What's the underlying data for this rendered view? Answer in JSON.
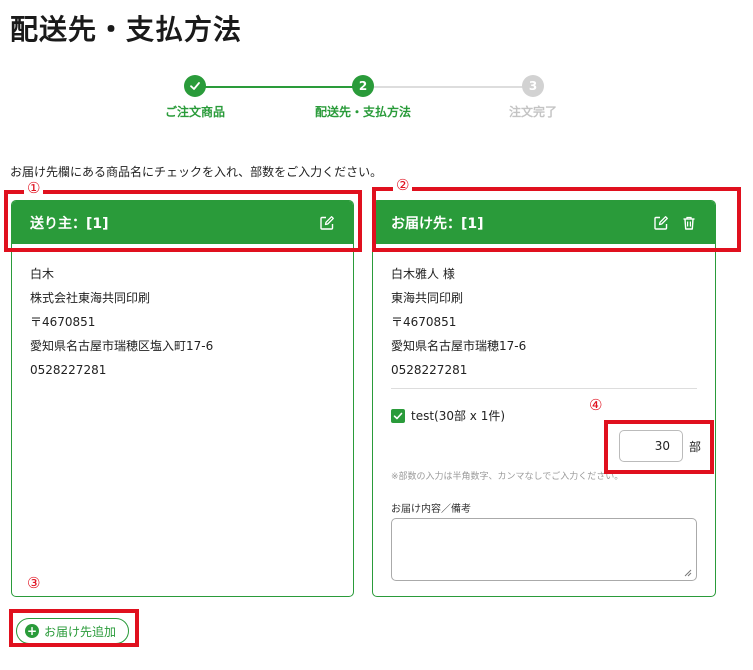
{
  "page_title": "配送先・支払方法",
  "stepper": {
    "steps": [
      {
        "number": "1",
        "label": "ご注文商品",
        "state": "done"
      },
      {
        "number": "2",
        "label": "配送先・支払方法",
        "state": "current"
      },
      {
        "number": "3",
        "label": "注文完了",
        "state": "todo"
      }
    ]
  },
  "instruction": "お届け先欄にある商品名にチェックを入れ、部数をご入力ください。",
  "sender": {
    "title": "送り主：[1]",
    "lines": [
      "白木",
      "株式会社東海共同印刷",
      "〒4670851",
      "愛知県名古屋市瑞穂区塩入町17-6",
      "0528227281"
    ]
  },
  "recipient": {
    "title": "お届け先：[1]",
    "lines": [
      "白木雅人 様",
      "東海共同印刷",
      "〒4670851",
      "愛知県名古屋市瑞穂17-6",
      "0528227281"
    ],
    "item_label": "test(30部 x 1件)",
    "item_checked": true,
    "quantity": "30",
    "quantity_unit": "部",
    "quantity_note": "※部数の入力は半角数字、カンマなしでご入力ください。",
    "memo_label": "お届け内容／備考",
    "memo_value": ""
  },
  "add_button_label": "お届け先追加",
  "annotations": [
    "①",
    "②",
    "③",
    "④"
  ],
  "colors": {
    "accent": "#2a9b3a",
    "annotation": "#e0101e",
    "inactive": "#d2d2d2"
  },
  "icons": [
    "check-icon",
    "edit-icon",
    "trash-icon",
    "plus-circle-icon"
  ]
}
